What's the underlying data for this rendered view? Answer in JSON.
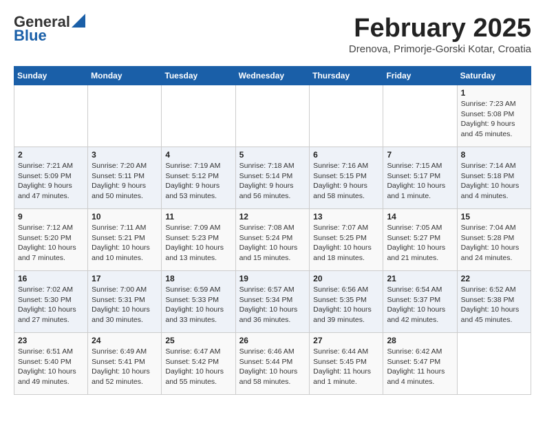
{
  "logo": {
    "general": "General",
    "blue": "Blue"
  },
  "title": "February 2025",
  "subtitle": "Drenova, Primorje-Gorski Kotar, Croatia",
  "calendar": {
    "headers": [
      "Sunday",
      "Monday",
      "Tuesday",
      "Wednesday",
      "Thursday",
      "Friday",
      "Saturday"
    ],
    "weeks": [
      [
        {
          "day": "",
          "info": ""
        },
        {
          "day": "",
          "info": ""
        },
        {
          "day": "",
          "info": ""
        },
        {
          "day": "",
          "info": ""
        },
        {
          "day": "",
          "info": ""
        },
        {
          "day": "",
          "info": ""
        },
        {
          "day": "1",
          "info": "Sunrise: 7:23 AM\nSunset: 5:08 PM\nDaylight: 9 hours and 45 minutes."
        }
      ],
      [
        {
          "day": "2",
          "info": "Sunrise: 7:21 AM\nSunset: 5:09 PM\nDaylight: 9 hours and 47 minutes."
        },
        {
          "day": "3",
          "info": "Sunrise: 7:20 AM\nSunset: 5:11 PM\nDaylight: 9 hours and 50 minutes."
        },
        {
          "day": "4",
          "info": "Sunrise: 7:19 AM\nSunset: 5:12 PM\nDaylight: 9 hours and 53 minutes."
        },
        {
          "day": "5",
          "info": "Sunrise: 7:18 AM\nSunset: 5:14 PM\nDaylight: 9 hours and 56 minutes."
        },
        {
          "day": "6",
          "info": "Sunrise: 7:16 AM\nSunset: 5:15 PM\nDaylight: 9 hours and 58 minutes."
        },
        {
          "day": "7",
          "info": "Sunrise: 7:15 AM\nSunset: 5:17 PM\nDaylight: 10 hours and 1 minute."
        },
        {
          "day": "8",
          "info": "Sunrise: 7:14 AM\nSunset: 5:18 PM\nDaylight: 10 hours and 4 minutes."
        }
      ],
      [
        {
          "day": "9",
          "info": "Sunrise: 7:12 AM\nSunset: 5:20 PM\nDaylight: 10 hours and 7 minutes."
        },
        {
          "day": "10",
          "info": "Sunrise: 7:11 AM\nSunset: 5:21 PM\nDaylight: 10 hours and 10 minutes."
        },
        {
          "day": "11",
          "info": "Sunrise: 7:09 AM\nSunset: 5:23 PM\nDaylight: 10 hours and 13 minutes."
        },
        {
          "day": "12",
          "info": "Sunrise: 7:08 AM\nSunset: 5:24 PM\nDaylight: 10 hours and 15 minutes."
        },
        {
          "day": "13",
          "info": "Sunrise: 7:07 AM\nSunset: 5:25 PM\nDaylight: 10 hours and 18 minutes."
        },
        {
          "day": "14",
          "info": "Sunrise: 7:05 AM\nSunset: 5:27 PM\nDaylight: 10 hours and 21 minutes."
        },
        {
          "day": "15",
          "info": "Sunrise: 7:04 AM\nSunset: 5:28 PM\nDaylight: 10 hours and 24 minutes."
        }
      ],
      [
        {
          "day": "16",
          "info": "Sunrise: 7:02 AM\nSunset: 5:30 PM\nDaylight: 10 hours and 27 minutes."
        },
        {
          "day": "17",
          "info": "Sunrise: 7:00 AM\nSunset: 5:31 PM\nDaylight: 10 hours and 30 minutes."
        },
        {
          "day": "18",
          "info": "Sunrise: 6:59 AM\nSunset: 5:33 PM\nDaylight: 10 hours and 33 minutes."
        },
        {
          "day": "19",
          "info": "Sunrise: 6:57 AM\nSunset: 5:34 PM\nDaylight: 10 hours and 36 minutes."
        },
        {
          "day": "20",
          "info": "Sunrise: 6:56 AM\nSunset: 5:35 PM\nDaylight: 10 hours and 39 minutes."
        },
        {
          "day": "21",
          "info": "Sunrise: 6:54 AM\nSunset: 5:37 PM\nDaylight: 10 hours and 42 minutes."
        },
        {
          "day": "22",
          "info": "Sunrise: 6:52 AM\nSunset: 5:38 PM\nDaylight: 10 hours and 45 minutes."
        }
      ],
      [
        {
          "day": "23",
          "info": "Sunrise: 6:51 AM\nSunset: 5:40 PM\nDaylight: 10 hours and 49 minutes."
        },
        {
          "day": "24",
          "info": "Sunrise: 6:49 AM\nSunset: 5:41 PM\nDaylight: 10 hours and 52 minutes."
        },
        {
          "day": "25",
          "info": "Sunrise: 6:47 AM\nSunset: 5:42 PM\nDaylight: 10 hours and 55 minutes."
        },
        {
          "day": "26",
          "info": "Sunrise: 6:46 AM\nSunset: 5:44 PM\nDaylight: 10 hours and 58 minutes."
        },
        {
          "day": "27",
          "info": "Sunrise: 6:44 AM\nSunset: 5:45 PM\nDaylight: 11 hours and 1 minute."
        },
        {
          "day": "28",
          "info": "Sunrise: 6:42 AM\nSunset: 5:47 PM\nDaylight: 11 hours and 4 minutes."
        },
        {
          "day": "",
          "info": ""
        }
      ]
    ]
  }
}
